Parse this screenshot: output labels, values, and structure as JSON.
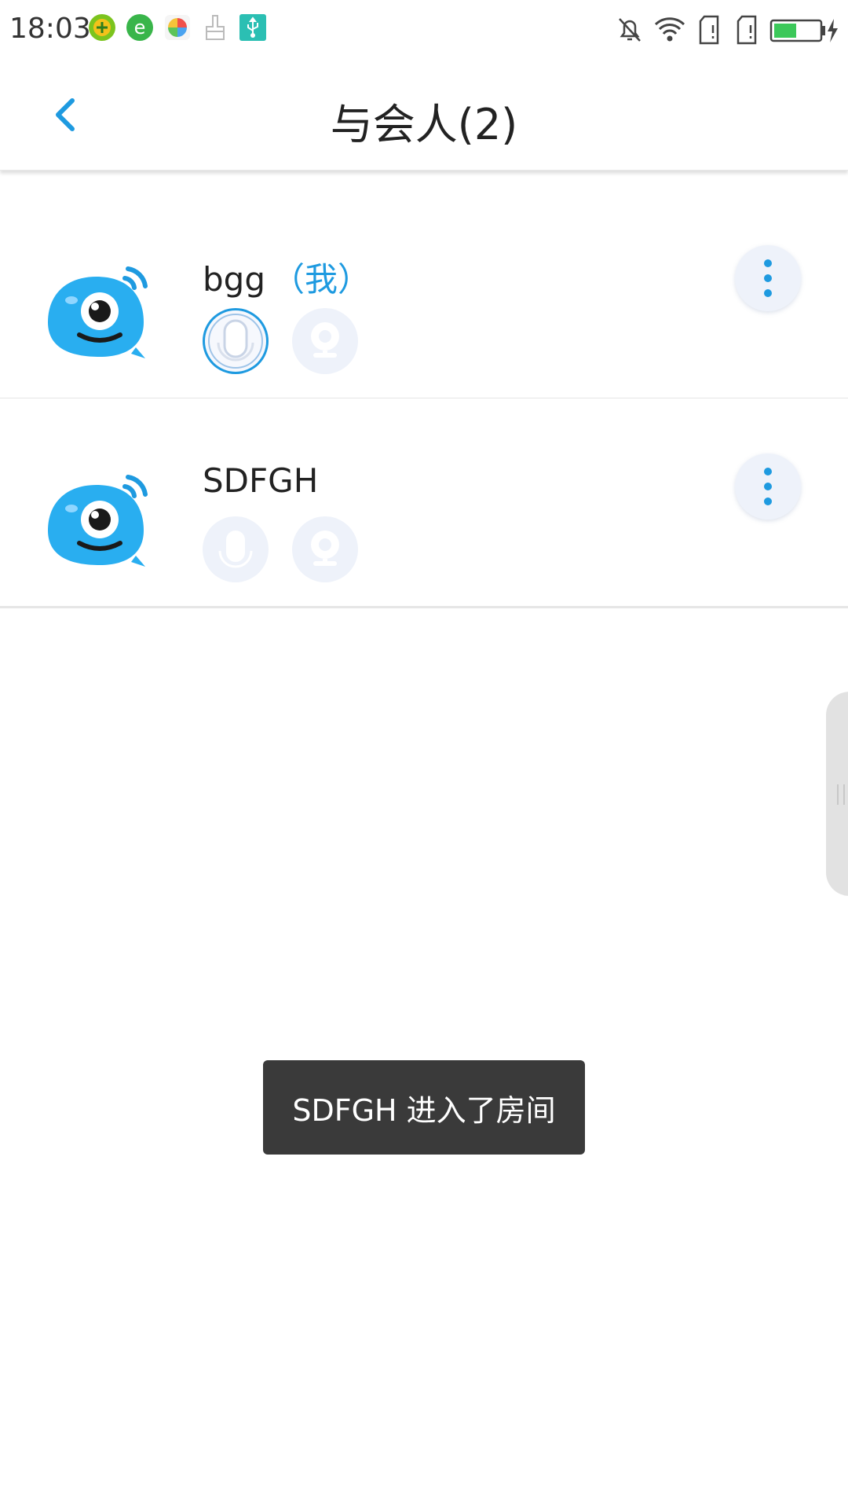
{
  "status_bar": {
    "time": "18:03",
    "notification_icons": [
      "app-green-plus-icon",
      "app-green-e-icon",
      "pinwheel-app-icon",
      "cleaner-icon",
      "usb-icon"
    ],
    "status_icons": [
      "mute-bell-icon",
      "wifi-icon",
      "sim-no-signal-icon",
      "sim-no-signal-icon",
      "battery-charging-icon"
    ]
  },
  "header": {
    "back_icon": "chevron-left-icon",
    "title": "与会人(2)"
  },
  "participants": [
    {
      "name": "bgg",
      "tag": "（我）",
      "mic_active": true,
      "camera_active": false
    },
    {
      "name": "SDFGH",
      "tag": "",
      "mic_active": false,
      "camera_active": false
    }
  ],
  "toast": {
    "message": "SDFGH 进入了房间"
  },
  "colors": {
    "accent": "#1e9ae0",
    "toast_bg": "#3a3a3a",
    "control_bg": "#eef2fa"
  }
}
